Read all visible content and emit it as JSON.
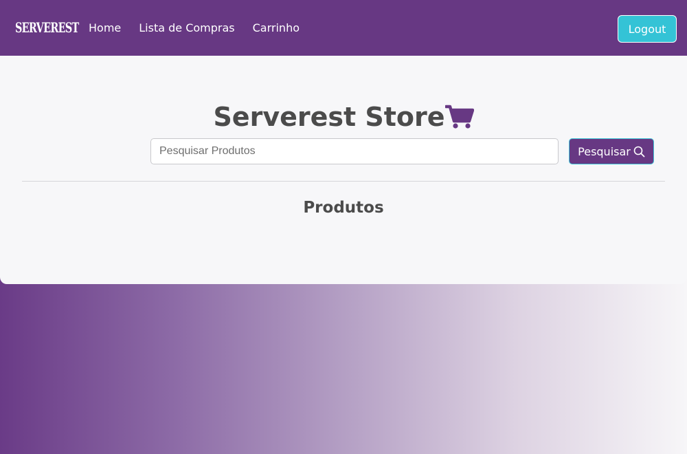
{
  "navbar": {
    "brand": "Serverest",
    "links": [
      {
        "label": "Home"
      },
      {
        "label": "Lista de Compras"
      },
      {
        "label": "Carrinho"
      }
    ],
    "logout_label": "Logout"
  },
  "store": {
    "title": "Serverest Store",
    "title_icon": "shopping-cart-icon"
  },
  "search": {
    "value": "",
    "placeholder": "Pesquisar Produtos",
    "button_label": "Pesquisar",
    "button_icon": "search-icon"
  },
  "products": {
    "heading": "Produtos",
    "items": []
  },
  "colors": {
    "primary": "#673883",
    "accent": "#34c3d6",
    "text": "#4b4b4b"
  }
}
